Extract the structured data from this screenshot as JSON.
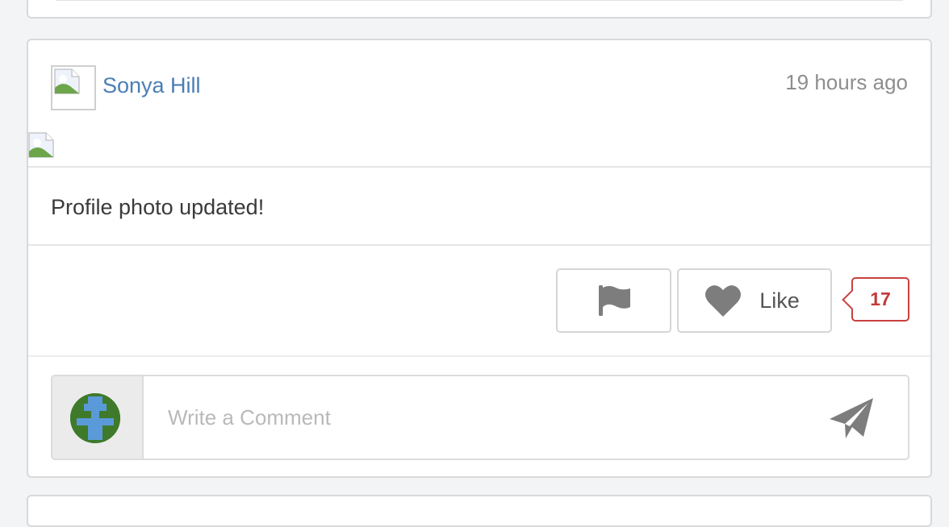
{
  "post": {
    "author": "Sonya Hill",
    "timestamp": "19 hours ago",
    "body": "Profile photo updated!"
  },
  "actions": {
    "like_label": "Like",
    "like_count": "17"
  },
  "comment": {
    "placeholder": "Write a Comment"
  },
  "colors": {
    "author_link": "#4a7eb5",
    "like_count": "#c23a3a",
    "icon_gray": "#7d7d7d"
  }
}
